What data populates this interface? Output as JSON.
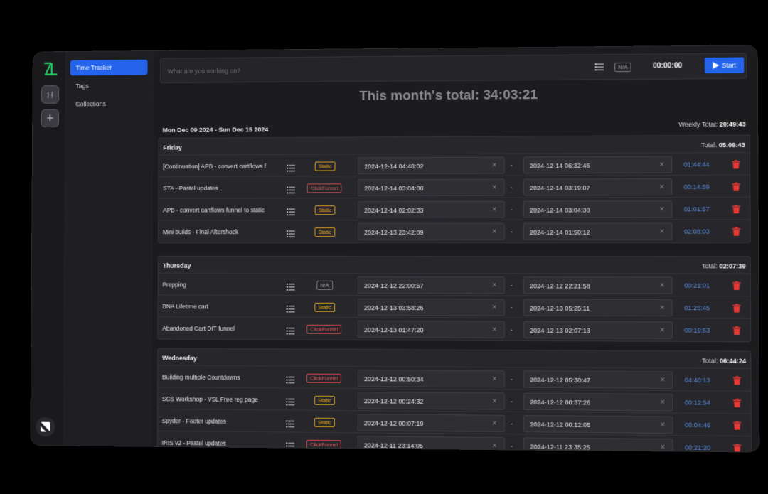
{
  "nav": {
    "workspace_initial": "H",
    "items": [
      "Time Tracker",
      "Tags",
      "Collections"
    ]
  },
  "topbar": {
    "placeholder": "What are you working on?",
    "tag": "N/A",
    "timer": "00:00:00",
    "start_label": "Start"
  },
  "month_total": "This month's total: 34:03:21",
  "week": {
    "range": "Mon Dec 09 2024 - Sun Dec 15 2024",
    "total_label": "Weekly Total:",
    "total_value": "20:49:43"
  },
  "colors": {
    "accent": "#2563eb",
    "static": "#f2b020",
    "clickfunnel": "#e05858",
    "duration": "#5b8fe0",
    "trash": "#e53935"
  },
  "days": [
    {
      "name": "Friday",
      "total_label": "Total:",
      "total_value": "05:09:43",
      "entries": [
        {
          "title": "[Continuation] APB - convert cartflows f",
          "tag": "Static",
          "start": "2024-12-14 04:48:02",
          "end": "2024-12-14 06:32:46",
          "duration": "01:44:44"
        },
        {
          "title": "STA - Pastel updates",
          "tag": "ClickFunnel",
          "start": "2024-12-14 03:04:08",
          "end": "2024-12-14 03:19:07",
          "duration": "00:14:59"
        },
        {
          "title": "APB - convert cartflows funnel to static",
          "tag": "Static",
          "start": "2024-12-14 02:02:33",
          "end": "2024-12-14 03:04:30",
          "duration": "01:01:57"
        },
        {
          "title": "Mini builds - Final Aftershock",
          "tag": "Static",
          "start": "2024-12-13 23:42:09",
          "end": "2024-12-14 01:50:12",
          "duration": "02:08:03"
        }
      ]
    },
    {
      "name": "Thursday",
      "total_label": "Total:",
      "total_value": "02:07:39",
      "entries": [
        {
          "title": "Prepping",
          "tag": "N/A",
          "start": "2024-12-12 22:00:57",
          "end": "2024-12-12 22:21:58",
          "duration": "00:21:01"
        },
        {
          "title": "BNA Lifetime cart",
          "tag": "Static",
          "start": "2024-12-13 03:58:26",
          "end": "2024-12-13 05:25:11",
          "duration": "01:26:45"
        },
        {
          "title": "Abandoned Cart DIT funnel",
          "tag": "ClickFunnel",
          "start": "2024-12-13 01:47:20",
          "end": "2024-12-13 02:07:13",
          "duration": "00:19:53"
        }
      ]
    },
    {
      "name": "Wednesday",
      "total_label": "Total:",
      "total_value": "06:44:24",
      "entries": [
        {
          "title": "Building multiple Countdowns",
          "tag": "ClickFunnel",
          "start": "2024-12-12 00:50:34",
          "end": "2024-12-12 05:30:47",
          "duration": "04:40:13"
        },
        {
          "title": "SCS Workshop - VSL Free reg page",
          "tag": "Static",
          "start": "2024-12-12 00:24:32",
          "end": "2024-12-12 00:37:26",
          "duration": "00:12:54"
        },
        {
          "title": "Spyder - Footer updates",
          "tag": "Static",
          "start": "2024-12-12 00:07:19",
          "end": "2024-12-12 00:12:05",
          "duration": "00:04:46"
        },
        {
          "title": "IRIS v2 - Pastel updates",
          "tag": "ClickFunnel",
          "start": "2024-12-11 23:14:05",
          "end": "2024-12-11 23:35:25",
          "duration": "00:21:20"
        }
      ]
    }
  ]
}
